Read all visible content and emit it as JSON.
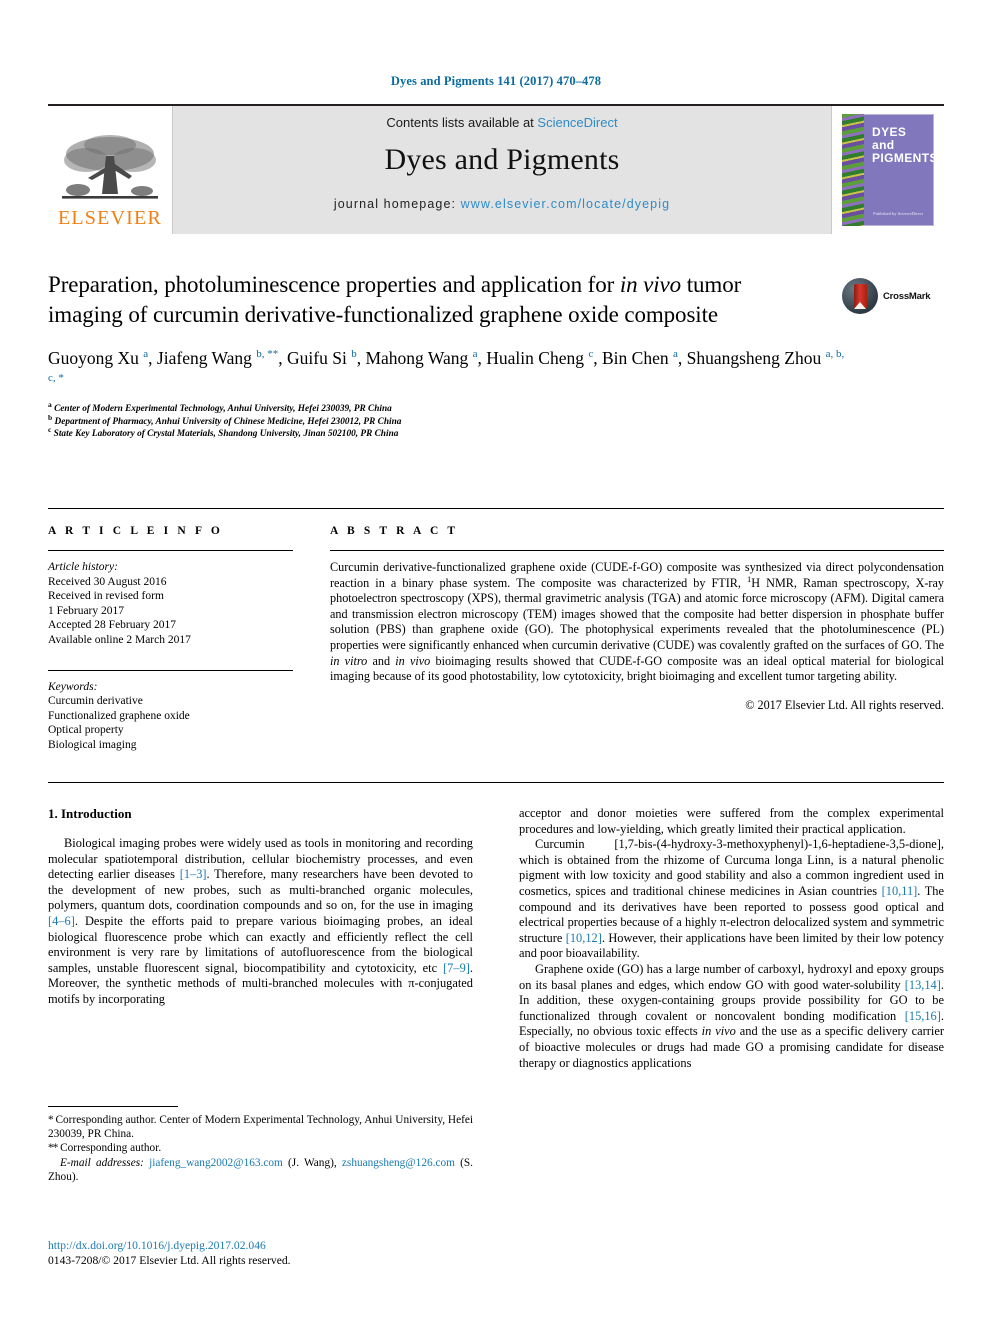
{
  "running_head": "Dyes and Pigments 141 (2017) 470–478",
  "masthead": {
    "publisher": "ELSEVIER",
    "contents_prefix": "Contents lists available at ",
    "contents_link": "ScienceDirect",
    "journal_title": "Dyes and Pigments",
    "homepage_label": "journal homepage: ",
    "homepage_url": "www.elsevier.com/locate/dyepig",
    "cover_title_line1": "DYES",
    "cover_title_line2": "and",
    "cover_title_line3": "PIGMENTS",
    "cover_footer": "Published by ScienceDirect"
  },
  "article": {
    "title_part1": "Preparation, photoluminescence properties and application for ",
    "title_italic": "in vivo",
    "title_part2": " tumor imaging of curcumin derivative-functionalized graphene oxide composite",
    "crossmark_label": "CrossMark",
    "authors": [
      {
        "name": "Guoyong Xu",
        "marks": "a",
        "sep": ", "
      },
      {
        "name": "Jiafeng Wang",
        "marks": "b, **",
        "sep": ", "
      },
      {
        "name": "Guifu Si",
        "marks": "b",
        "sep": ", "
      },
      {
        "name": "Mahong Wang",
        "marks": "a",
        "sep": ", "
      },
      {
        "name": "Hualin Cheng",
        "marks": "c",
        "sep": ", "
      },
      {
        "name": "Bin Chen",
        "marks": "a",
        "sep": ", "
      },
      {
        "name": "Shuangsheng Zhou",
        "marks": "a, b, c, *",
        "sep": ""
      }
    ],
    "affiliations": [
      {
        "mark": "a",
        "text": "Center of Modern Experimental Technology, Anhui University, Hefei 230039, PR China"
      },
      {
        "mark": "b",
        "text": "Department of Pharmacy, Anhui University of Chinese Medicine, Hefei 230012, PR China"
      },
      {
        "mark": "c",
        "text": "State Key Laboratory of Crystal Materials, Shandong University, Jinan 502100, PR China"
      }
    ]
  },
  "article_info": {
    "heading": "A R T I C L E  I N F O",
    "history_label": "Article history:",
    "history_lines": [
      "Received 30 August 2016",
      "Received in revised form",
      "1 February 2017",
      "Accepted 28 February 2017",
      "Available online 2 March 2017"
    ],
    "keywords_label": "Keywords:",
    "keywords": [
      "Curcumin derivative",
      "Functionalized graphene oxide",
      "Optical property",
      "Biological imaging"
    ]
  },
  "abstract": {
    "heading": "A B S T R A C T",
    "p1_a": "Curcumin derivative-functionalized graphene oxide (CUDE-f-GO) composite was synthesized via direct polycondensation reaction in a binary phase system. The composite was characterized by FTIR, ",
    "p1_sup": "1",
    "p1_b": "H NMR, Raman spectroscopy, X-ray photoelectron spectroscopy (XPS), thermal gravimetric analysis (TGA) and atomic force microscopy (AFM). Digital camera and transmission electron microscopy (TEM) images showed that the composite had better dispersion in phosphate buffer solution (PBS) than graphene oxide (GO). The photophysical experiments revealed that the photoluminescence (PL) properties were significantly enhanced when curcumin derivative (CUDE) was covalently grafted on the surfaces of GO. The ",
    "p1_it1": "in vitro",
    "p1_c": " and ",
    "p1_it2": "in vivo",
    "p1_d": " bioimaging results showed that CUDE-f-GO composite was an ideal optical material for biological imaging because of its good photostability, low cytotoxicity, bright bioimaging and excellent tumor targeting ability.",
    "copyright": "© 2017 Elsevier Ltd. All rights reserved."
  },
  "introduction": {
    "section_number_title": "1. Introduction",
    "left_p1_a": "Biological imaging probes were widely used as tools in monitoring and recording molecular spatiotemporal distribution, cellular biochemistry processes, and even detecting earlier diseases ",
    "left_p1_ref1": "[1–3]",
    "left_p1_b": ". Therefore, many researchers have been devoted to the development of new probes, such as multi-branched organic molecules, polymers, quantum dots, coordination compounds and so on, for the use in imaging ",
    "left_p1_ref2": "[4–6]",
    "left_p1_c": ". Despite the efforts paid to prepare various bioimaging probes, an ideal biological fluorescence probe which can exactly and efficiently reflect the cell environment is very rare by limitations of autofluorescence from the biological samples, unstable fluorescent signal, biocompatibility and cytotoxicity, etc ",
    "left_p1_ref3": "[7–9]",
    "left_p1_d": ". Moreover, the synthetic methods of multi-branched molecules with π-conjugated motifs by incorporating",
    "right_p1": "acceptor and donor moieties were suffered from the complex experimental procedures and low-yielding, which greatly limited their practical application.",
    "right_p2_a": "Curcumin            [1,7-bis-(4-hydroxy-3-methoxyphenyl)-1,6-heptadiene-3,5-dione], which is obtained from the rhizome of Curcuma longa Linn, is a natural phenolic pigment with low toxicity and good stability and also a common ingredient used in cosmetics, spices and traditional chinese medicines in Asian countries ",
    "right_p2_ref1": "[10,11]",
    "right_p2_b": ". The compound and its derivatives have been reported to possess good optical and electrical properties because of a highly π-electron delocalized system and symmetric structure ",
    "right_p2_ref2": "[10,12]",
    "right_p2_c": ". However, their applications have been limited by their low potency and poor bioavailability.",
    "right_p3_a": "Graphene oxide (GO) has a large number of carboxyl, hydroxyl and epoxy groups on its basal planes and edges, which endow GO with good water-solubility ",
    "right_p3_ref1": "[13,14]",
    "right_p3_b": ". In addition, these oxygen-containing groups provide possibility for GO to be functionalized through covalent or noncovalent bonding modification ",
    "right_p3_ref2": "[15,16]",
    "right_p3_c": ". Especially, no obvious toxic effects ",
    "right_p3_it": "in vivo",
    "right_p3_d": " and the use as a specific delivery carrier of bioactive molecules or drugs had made GO a promising candidate for disease therapy or diagnostics applications"
  },
  "footnotes": {
    "fn1_mark": "*",
    "fn1_text": " Corresponding author. Center of Modern Experimental Technology, Anhui University, Hefei 230039, PR China.",
    "fn2_mark": "**",
    "fn2_text": " Corresponding author.",
    "email_label": "E-mail addresses:",
    "email1": "jiafeng_wang2002@163.com",
    "email1_owner": " (J. Wang), ",
    "email2": "zshuangsheng@126.com",
    "email2_owner": " (S. Zhou).",
    "doi": "http://dx.doi.org/10.1016/j.dyepig.2017.02.046",
    "issn_line": "0143-7208/© 2017 Elsevier Ltd. All rights reserved."
  },
  "colors": {
    "link": "#1a7ab0",
    "running_head": "#0b6ba0",
    "elsevier_orange": "#f07f13",
    "masthead_bg": "#e3e3e3",
    "cover_purple": "#8177bd"
  }
}
